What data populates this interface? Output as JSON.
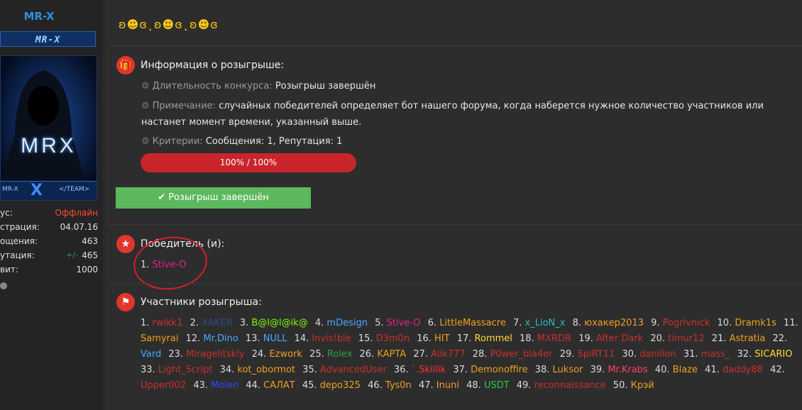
{
  "user": {
    "name": "MR-X",
    "banner": "MR-X",
    "avatar_brand": "MRX",
    "avatar_strip_left": "MR-X",
    "avatar_strip_center": "X",
    "avatar_strip_right": "</TEAM>",
    "stats": [
      {
        "label": "ус:",
        "value": "Оффлайн"
      },
      {
        "label": "страция:",
        "value": "04.07.16"
      },
      {
        "label": "ощения:",
        "value": "463"
      },
      {
        "label": "утация:",
        "value": "465",
        "prefix": "+/-"
      },
      {
        "label": "вит:",
        "value": "1000"
      }
    ]
  },
  "post": {
    "faces": "ʚ☻ɞ˛ʚ☻ɞ˛ʚ☻ɞ",
    "info_title": "Информация о розыгрыше:",
    "duration_key": "Длительность конкурса:",
    "duration_val": "Розыгрыш завершён",
    "note_key": "Примечание:",
    "note_val": "случайных победителей определяет бот нашего форума, когда наберется нужное количество участников или настанет момент времени, указанный выше.",
    "criteria_key": "Критерии:",
    "criteria_val": "Сообщения: 1, Репутация: 1",
    "progress_label": "100% / 100%",
    "progress_value": 1.0,
    "done_label": "Розыгрыш завершён",
    "winners_title": "Победитель (и):",
    "winner_num": "1.",
    "winner_name": "Stive-O",
    "participants_title": "Участники розыгрыша:"
  },
  "participants": [
    {
      "n": "1.",
      "name": "rwikk1",
      "color": "#c9302c"
    },
    {
      "n": "2.",
      "name": "XAKER",
      "color": "#2a4d8f"
    },
    {
      "n": "3.",
      "name": "B@l@l@ik@",
      "color": "#7cfc00"
    },
    {
      "n": "4.",
      "name": "mDesign",
      "color": "#4aa8ff"
    },
    {
      "n": "5.",
      "name": "Stive-O",
      "color": "#e91e8c"
    },
    {
      "n": "6.",
      "name": "LittleMassacre",
      "color": "#f0a020"
    },
    {
      "n": "7.",
      "name": "x_LioN_x",
      "color": "#20c0c0"
    },
    {
      "n": "8.",
      "name": "юхакер2013",
      "color": "#f0a020"
    },
    {
      "n": "9.",
      "name": "Pogrivnick",
      "color": "#c9302c"
    },
    {
      "n": "10.",
      "name": "Dramk1s",
      "color": "#f0a020"
    },
    {
      "n": "11.",
      "name": "Samyrai",
      "color": "#f0a020"
    },
    {
      "n": "12.",
      "name": "Mr.Dino",
      "color": "#4aa8ff"
    },
    {
      "n": "13.",
      "name": "NULL",
      "color": "#4aa8ff"
    },
    {
      "n": "14.",
      "name": "Invis!ble",
      "color": "#c9302c"
    },
    {
      "n": "15.",
      "name": "D3m0n",
      "color": "#c9302c"
    },
    {
      "n": "16.",
      "name": "HIT",
      "color": "#f0a020"
    },
    {
      "n": "17.",
      "name": "Rommel",
      "color": "#ffdd33"
    },
    {
      "n": "18.",
      "name": "MXRDR",
      "color": "#c9302c"
    },
    {
      "n": "19.",
      "name": "After Dark",
      "color": "#c9302c"
    },
    {
      "n": "20.",
      "name": "timur12",
      "color": "#c9302c"
    },
    {
      "n": "21.",
      "name": "Astratia",
      "color": "#f0a020"
    },
    {
      "n": "22.",
      "name": "Vard",
      "color": "#4aa8ff"
    },
    {
      "n": "23.",
      "name": "Miragelitskiy",
      "color": "#c9302c"
    },
    {
      "n": "24.",
      "name": "Ezwork",
      "color": "#f0a020"
    },
    {
      "n": "25.",
      "name": "Rolex",
      "color": "#2e9f4a"
    },
    {
      "n": "26.",
      "name": "KAPTA",
      "color": "#f0a020"
    },
    {
      "n": "27.",
      "name": "Alik777",
      "color": "#c9302c"
    },
    {
      "n": "28.",
      "name": "P0wer_bla4er",
      "color": "#c9302c"
    },
    {
      "n": "29.",
      "name": "SpiRT11",
      "color": "#c9302c"
    },
    {
      "n": "30.",
      "name": "danilion",
      "color": "#c9302c"
    },
    {
      "n": "31.",
      "name": "mass_",
      "color": "#c9302c"
    },
    {
      "n": "32.",
      "name": "SICARIO",
      "color": "#ffdd33"
    },
    {
      "n": "33.",
      "name": "Light_Script",
      "color": "#c9302c"
    },
    {
      "n": "34.",
      "name": "kot_obormot",
      "color": "#f0a020"
    },
    {
      "n": "35.",
      "name": "AdvancedUser",
      "color": "#c9302c"
    },
    {
      "n": "36.",
      "name": "`.Skillik",
      "color": "#ff3030"
    },
    {
      "n": "37.",
      "name": "Demonoffire",
      "color": "#f0a020"
    },
    {
      "n": "38.",
      "name": "Luksor",
      "color": "#f0a020"
    },
    {
      "n": "39.",
      "name": "Mr.Krabs",
      "color": "#ff4060"
    },
    {
      "n": "40.",
      "name": "Blaze",
      "color": "#f0a020"
    },
    {
      "n": "41.",
      "name": "daddy88",
      "color": "#c9302c"
    },
    {
      "n": "42.",
      "name": "Upper002",
      "color": "#c9302c"
    },
    {
      "n": "43.",
      "name": "Molen",
      "color": "#3344ff"
    },
    {
      "n": "44.",
      "name": "САЛАТ",
      "color": "#f0a020"
    },
    {
      "n": "45.",
      "name": "depo325",
      "color": "#f0a020"
    },
    {
      "n": "46.",
      "name": "Tys0n",
      "color": "#f0a020"
    },
    {
      "n": "47.",
      "name": "Inuni",
      "color": "#f0a020"
    },
    {
      "n": "48.",
      "name": "USDT",
      "color": "#22cc44"
    },
    {
      "n": "49.",
      "name": "reconnaissance",
      "color": "#c9302c"
    },
    {
      "n": "50.",
      "name": "Крэй",
      "color": "#f0a020"
    }
  ]
}
